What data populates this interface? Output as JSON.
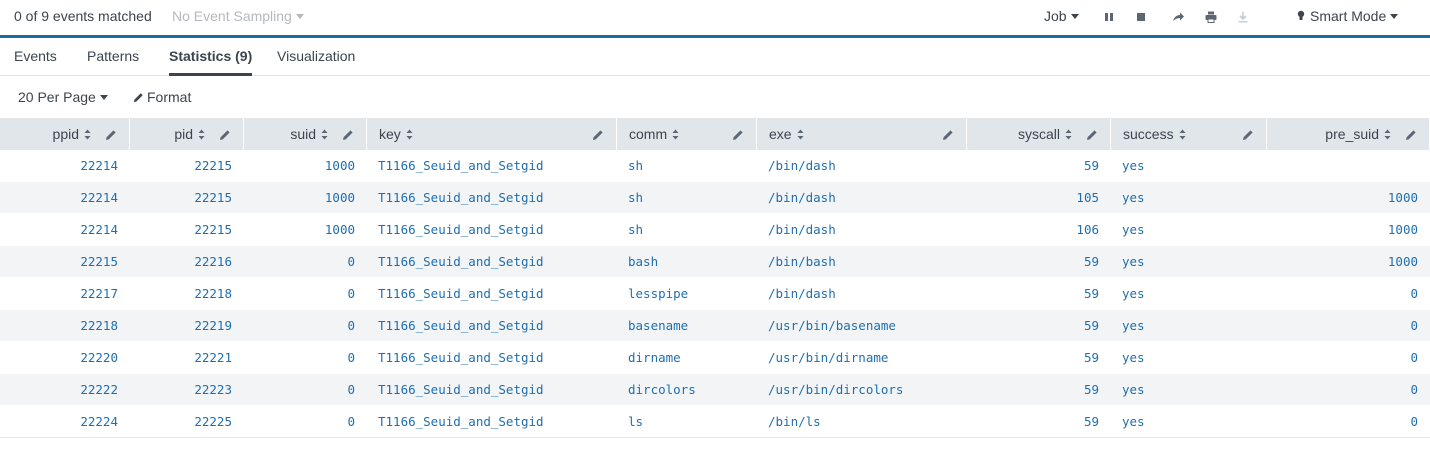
{
  "status": {
    "matched": "0 of 9 events matched",
    "sampling": "No Event Sampling",
    "job": "Job",
    "mode": "Smart Mode"
  },
  "tabs": [
    {
      "label": "Events",
      "active": false
    },
    {
      "label": "Patterns",
      "active": false
    },
    {
      "label": "Statistics (9)",
      "active": true
    },
    {
      "label": "Visualization",
      "active": false
    }
  ],
  "controls": {
    "per_page": "20 Per Page",
    "format": "Format"
  },
  "icons": {
    "pause": "pause-icon",
    "stop": "stop-icon",
    "share": "share-icon",
    "print": "print-icon",
    "export": "export-icon",
    "mode": "lightbulb-icon"
  },
  "colors": {
    "accent": "#1a6e9e",
    "link": "#1f6fb0",
    "header_bg": "#e1e6eb",
    "row_alt": "#f2f4f5"
  },
  "table": {
    "columns": [
      "ppid",
      "pid",
      "suid",
      "key",
      "comm",
      "exe",
      "syscall",
      "success",
      "pre_suid"
    ],
    "rows": [
      [
        "22214",
        "22215",
        "1000",
        "T1166_Seuid_and_Setgid",
        "sh",
        "/bin/dash",
        "59",
        "yes",
        ""
      ],
      [
        "22214",
        "22215",
        "1000",
        "T1166_Seuid_and_Setgid",
        "sh",
        "/bin/dash",
        "105",
        "yes",
        "1000"
      ],
      [
        "22214",
        "22215",
        "1000",
        "T1166_Seuid_and_Setgid",
        "sh",
        "/bin/dash",
        "106",
        "yes",
        "1000"
      ],
      [
        "22215",
        "22216",
        "0",
        "T1166_Seuid_and_Setgid",
        "bash",
        "/bin/bash",
        "59",
        "yes",
        "1000"
      ],
      [
        "22217",
        "22218",
        "0",
        "T1166_Seuid_and_Setgid",
        "lesspipe",
        "/bin/dash",
        "59",
        "yes",
        "0"
      ],
      [
        "22218",
        "22219",
        "0",
        "T1166_Seuid_and_Setgid",
        "basename",
        "/usr/bin/basename",
        "59",
        "yes",
        "0"
      ],
      [
        "22220",
        "22221",
        "0",
        "T1166_Seuid_and_Setgid",
        "dirname",
        "/usr/bin/dirname",
        "59",
        "yes",
        "0"
      ],
      [
        "22222",
        "22223",
        "0",
        "T1166_Seuid_and_Setgid",
        "dircolors",
        "/usr/bin/dircolors",
        "59",
        "yes",
        "0"
      ],
      [
        "22224",
        "22225",
        "0",
        "T1166_Seuid_and_Setgid",
        "ls",
        "/bin/ls",
        "59",
        "yes",
        "0"
      ]
    ]
  }
}
